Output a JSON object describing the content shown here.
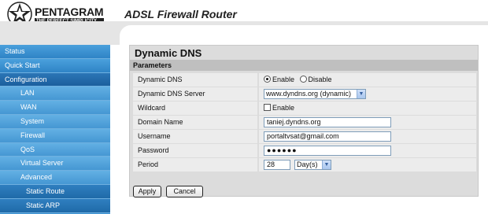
{
  "header": {
    "brand": "PENTAGRAM",
    "tagline": "THE PERFECT SIMPLICITY",
    "product_title": "ADSL Firewall Router"
  },
  "sidebar": {
    "items": [
      {
        "label": "Status",
        "level": 0
      },
      {
        "label": "Quick Start",
        "level": 0
      },
      {
        "label": "Configuration",
        "level": 0
      },
      {
        "label": "LAN",
        "level": 1
      },
      {
        "label": "WAN",
        "level": 1
      },
      {
        "label": "System",
        "level": 1
      },
      {
        "label": "Firewall",
        "level": 1
      },
      {
        "label": "QoS",
        "level": 1
      },
      {
        "label": "Virtual Server",
        "level": 1
      },
      {
        "label": "Advanced",
        "level": 1
      },
      {
        "label": "Static Route",
        "level": 2
      },
      {
        "label": "Static ARP",
        "level": 2
      }
    ]
  },
  "main": {
    "title": "Dynamic DNS",
    "section": "Parameters",
    "fields": {
      "dynamic_dns": {
        "label": "Dynamic DNS",
        "options": [
          "Enable",
          "Disable"
        ],
        "selected": "Enable"
      },
      "server": {
        "label": "Dynamic DNS Server",
        "value": "www.dyndns.org (dynamic)"
      },
      "wildcard": {
        "label": "Wildcard",
        "option": "Enable",
        "checked": false
      },
      "domain": {
        "label": "Domain Name",
        "value": "taniej.dyndns.org"
      },
      "username": {
        "label": "Username",
        "value": "portaltvsat@gmail.com"
      },
      "password": {
        "label": "Password",
        "value": "●●●●●●"
      },
      "period": {
        "label": "Period",
        "value": "28",
        "unit": "Day(s)"
      }
    },
    "buttons": {
      "apply": "Apply",
      "cancel": "Cancel"
    }
  },
  "colors": {
    "sidebar": "#3a8fcf",
    "panel": "#dcdcdc",
    "field_row": "#ececec"
  },
  "icons": {
    "logo": "pentagram-star-logo-icon",
    "dropdown": "chevron-down-icon"
  }
}
